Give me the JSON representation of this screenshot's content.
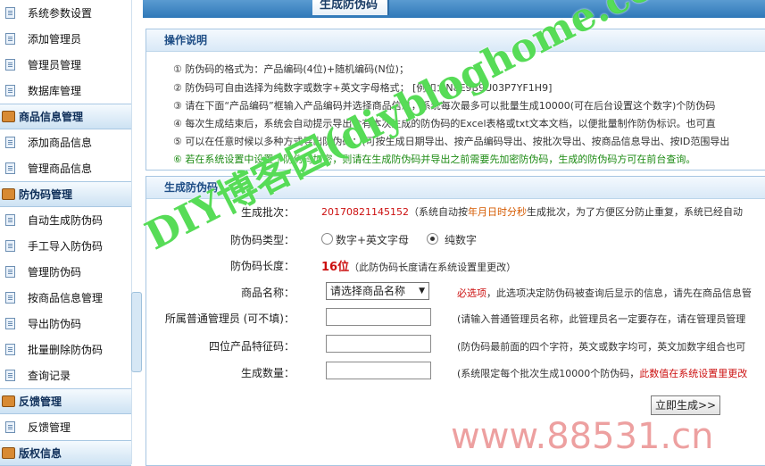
{
  "sidebar": {
    "items": [
      {
        "type": "item",
        "label": "系统参数设置"
      },
      {
        "type": "item",
        "label": "添加管理员"
      },
      {
        "type": "item",
        "label": "管理员管理"
      },
      {
        "type": "item",
        "label": "数据库管理"
      },
      {
        "type": "group",
        "label": "商品信息管理"
      },
      {
        "type": "item",
        "label": "添加商品信息"
      },
      {
        "type": "item",
        "label": "管理商品信息"
      },
      {
        "type": "group",
        "label": "防伪码管理"
      },
      {
        "type": "item",
        "label": "自动生成防伪码"
      },
      {
        "type": "item",
        "label": "手工导入防伪码"
      },
      {
        "type": "item",
        "label": "管理防伪码"
      },
      {
        "type": "item",
        "label": "按商品信息管理"
      },
      {
        "type": "item",
        "label": "导出防伪码"
      },
      {
        "type": "item",
        "label": "批量删除防伪码"
      },
      {
        "type": "item",
        "label": "查询记录"
      },
      {
        "type": "group",
        "label": "反馈管理"
      },
      {
        "type": "item",
        "label": "反馈管理"
      },
      {
        "type": "group",
        "label": "版权信息"
      }
    ]
  },
  "topbar": {
    "tab_title": "生成防伪码"
  },
  "instructions": {
    "title": "操作说明",
    "lines": [
      "① 防伪码的格式为：产品编码(4位)+随机编码(N位)；",
      "② 防伪码可自由选择为纯数字或数字+英文字母格式；  [例如：N8E9B9U03P7YF1H9]",
      "③ 请在下面“产品编码”框输入产品编码并选择商品信息，系统每次最多可以批量生成10000(可在后台设置这个数字)个防伪码",
      "④ 每次生成结束后，系统会自动提示导出含有本次生成的防伪码的Excel表格或txt文本文档，以便批量制作防伪标识。也可直",
      "⑤ 可以在任意时候以多种方式导出防伪码：(可按生成日期导出、按产品编码导出、按批次导出、按商品信息导出、按ID范围导出",
      "⑥ 若在系统设置中设置了防伪码加密，则请在生成防伪码并导出之前需要先加密防伪码，生成的防伪码方可在前台查询。"
    ]
  },
  "generate": {
    "title": "生成防伪码",
    "batch_label": "生成批次：",
    "batch_value": "20170821145152",
    "batch_note_pre": "（系统自动按",
    "batch_note_em": "年月日时分秒",
    "batch_note_post": "生成批次，为了方便区分防止重复，系统已经自动",
    "type_label": "防伪码类型：",
    "type_option1": "数字+英文字母",
    "type_option2": "纯数字",
    "length_label": "防伪码长度：",
    "length_value": "16位",
    "length_note": "（此防伪码长度请在系统设置里更改）",
    "product_label": "商品名称：",
    "product_select": "请选择商品名称",
    "product_note_req": "必选项",
    "product_note": "，此选项决定防伪码被查询后显示的信息，请先在商品信息管",
    "manager_label": "所属普通管理员 (可不填)：",
    "manager_note": "(请输入普通管理员名称，此管理员名一定要存在，请在管理员管理",
    "code4_label": "四位产品特征码：",
    "code4_note": "(防伪码最前面的四个字符，英文或数字均可，英文加数字组合也可",
    "count_label": "生成数量：",
    "count_note_pre": "(系统限定每个批次生成10000个防伪码，",
    "count_note_red": "此数值在系统设置里更改",
    "submit_label": "立即生成>>"
  },
  "watermarks": {
    "blog": "DIY博客园(diybloghome.com)",
    "site": "www.88531.cn"
  },
  "colors": {
    "accent": "#2f78b8",
    "required_red": "#cc1010",
    "tip_green": "#1b8a12"
  }
}
